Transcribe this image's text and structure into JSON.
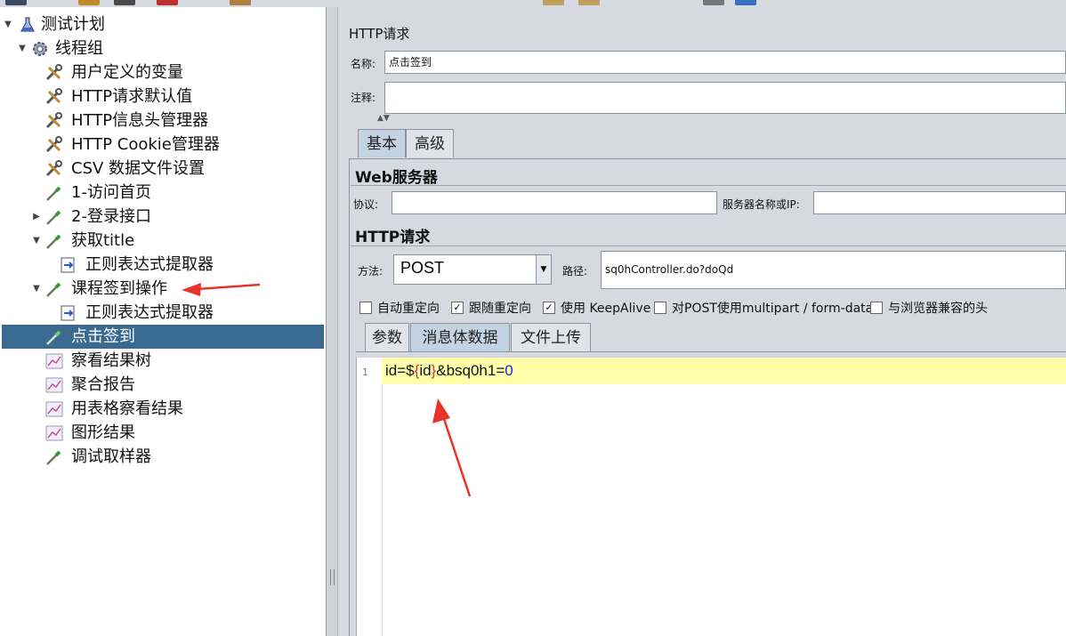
{
  "tree": {
    "items": [
      {
        "label": "测试计划",
        "icon": "test-plan-icon",
        "twisty": "▼",
        "selected": false
      },
      {
        "label": "线程组",
        "icon": "gear-icon",
        "twisty": "▼",
        "selected": false
      },
      {
        "label": "用户定义的变量",
        "icon": "wrench-icon",
        "twisty": "",
        "selected": false
      },
      {
        "label": "HTTP请求默认值",
        "icon": "wrench-icon",
        "twisty": "",
        "selected": false
      },
      {
        "label": "HTTP信息头管理器",
        "icon": "wrench-icon",
        "twisty": "",
        "selected": false
      },
      {
        "label": "HTTP Cookie管理器",
        "icon": "wrench-icon",
        "twisty": "",
        "selected": false
      },
      {
        "label": "CSV 数据文件设置",
        "icon": "wrench-icon",
        "twisty": "",
        "selected": false
      },
      {
        "label": "1-访问首页",
        "icon": "pipette-icon",
        "twisty": "",
        "selected": false
      },
      {
        "label": "2-登录接口",
        "icon": "pipette-icon",
        "twisty": "▶",
        "selected": false
      },
      {
        "label": "获取title",
        "icon": "pipette-icon",
        "twisty": "▼",
        "selected": false
      },
      {
        "label": "正则表达式提取器",
        "icon": "extractor-icon",
        "twisty": "",
        "selected": false
      },
      {
        "label": "课程签到操作",
        "icon": "pipette-icon",
        "twisty": "▼",
        "selected": false
      },
      {
        "label": "正则表达式提取器",
        "icon": "extractor-icon",
        "twisty": "",
        "selected": false
      },
      {
        "label": "点击签到",
        "icon": "pipette-icon",
        "twisty": "",
        "selected": true
      },
      {
        "label": "察看结果树",
        "icon": "graph-icon",
        "twisty": "",
        "selected": false
      },
      {
        "label": "聚合报告",
        "icon": "graph-icon",
        "twisty": "",
        "selected": false
      },
      {
        "label": "用表格察看结果",
        "icon": "graph-icon",
        "twisty": "",
        "selected": false
      },
      {
        "label": "图形结果",
        "icon": "graph-icon",
        "twisty": "",
        "selected": false
      },
      {
        "label": "调试取样器",
        "icon": "pipette-icon",
        "twisty": "",
        "selected": false
      }
    ]
  },
  "panel": {
    "title": "HTTP请求",
    "name_label": "名称:",
    "name_value": "点击签到",
    "comment_label": "注释:",
    "comment_value": "",
    "tabs": [
      "基本",
      "高级"
    ],
    "web_server_title": "Web服务器",
    "protocol_label": "协议:",
    "protocol_value": "",
    "server_label": "服务器名称或IP:",
    "server_value": "",
    "http_title": "HTTP请求",
    "method_label": "方法:",
    "method_value": "POST",
    "path_label": "路径:",
    "path_value": "sq0hController.do?doQd",
    "checkboxes": [
      {
        "label": "自动重定向",
        "checked": false
      },
      {
        "label": "跟随重定向",
        "checked": true
      },
      {
        "label": "使用 KeepAlive",
        "checked": true
      },
      {
        "label": "对POST使用multipart / form-data",
        "checked": false
      },
      {
        "label": "与浏览器兼容的头",
        "checked": false
      }
    ],
    "body_tabs": [
      "参数",
      "消息体数据",
      "文件上传"
    ],
    "body_active_tab": 1,
    "body_line_number": "1",
    "body_code": {
      "p1": "id=$",
      "p2": "{",
      "p3": "id",
      "p4": "}",
      "p5": "&bsq0h1=",
      "p6": "0"
    }
  },
  "colors": {
    "selection": "#3a6a90",
    "annotation_arrow": "#e8332a",
    "editor_highlight": "#ffffaa"
  }
}
